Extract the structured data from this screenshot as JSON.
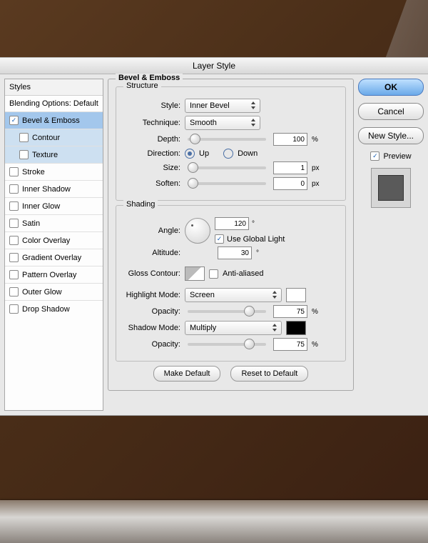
{
  "dialog": {
    "title": "Layer Style"
  },
  "sidebar": {
    "header": "Styles",
    "blending": "Blending Options: Default",
    "items": [
      {
        "label": "Bevel & Emboss",
        "checked": true,
        "active": true
      },
      {
        "label": "Contour",
        "checked": false,
        "sub": true
      },
      {
        "label": "Texture",
        "checked": false,
        "sub": true
      },
      {
        "label": "Stroke",
        "checked": false
      },
      {
        "label": "Inner Shadow",
        "checked": false
      },
      {
        "label": "Inner Glow",
        "checked": false
      },
      {
        "label": "Satin",
        "checked": false
      },
      {
        "label": "Color Overlay",
        "checked": false
      },
      {
        "label": "Gradient Overlay",
        "checked": false
      },
      {
        "label": "Pattern Overlay",
        "checked": false
      },
      {
        "label": "Outer Glow",
        "checked": false
      },
      {
        "label": "Drop Shadow",
        "checked": false
      }
    ]
  },
  "panel": {
    "title": "Bevel & Emboss",
    "structure": {
      "legend": "Structure",
      "style_label": "Style:",
      "style_value": "Inner Bevel",
      "technique_label": "Technique:",
      "technique_value": "Smooth",
      "depth_label": "Depth:",
      "depth_value": "100",
      "depth_unit": "%",
      "direction_label": "Direction:",
      "direction_up": "Up",
      "direction_down": "Down",
      "size_label": "Size:",
      "size_value": "1",
      "size_unit": "px",
      "soften_label": "Soften:",
      "soften_value": "0",
      "soften_unit": "px"
    },
    "shading": {
      "legend": "Shading",
      "angle_label": "Angle:",
      "angle_value": "120",
      "angle_unit": "°",
      "global_light": "Use Global Light",
      "altitude_label": "Altitude:",
      "altitude_value": "30",
      "altitude_unit": "°",
      "gloss_label": "Gloss Contour:",
      "antialiased": "Anti-aliased",
      "highlight_mode_label": "Highlight Mode:",
      "highlight_mode_value": "Screen",
      "highlight_opacity_label": "Opacity:",
      "highlight_opacity_value": "75",
      "opacity_unit": "%",
      "shadow_mode_label": "Shadow Mode:",
      "shadow_mode_value": "Multiply",
      "shadow_opacity_label": "Opacity:",
      "shadow_opacity_value": "75"
    },
    "make_default": "Make Default",
    "reset_default": "Reset to Default"
  },
  "right": {
    "ok": "OK",
    "cancel": "Cancel",
    "new_style": "New Style...",
    "preview": "Preview"
  }
}
